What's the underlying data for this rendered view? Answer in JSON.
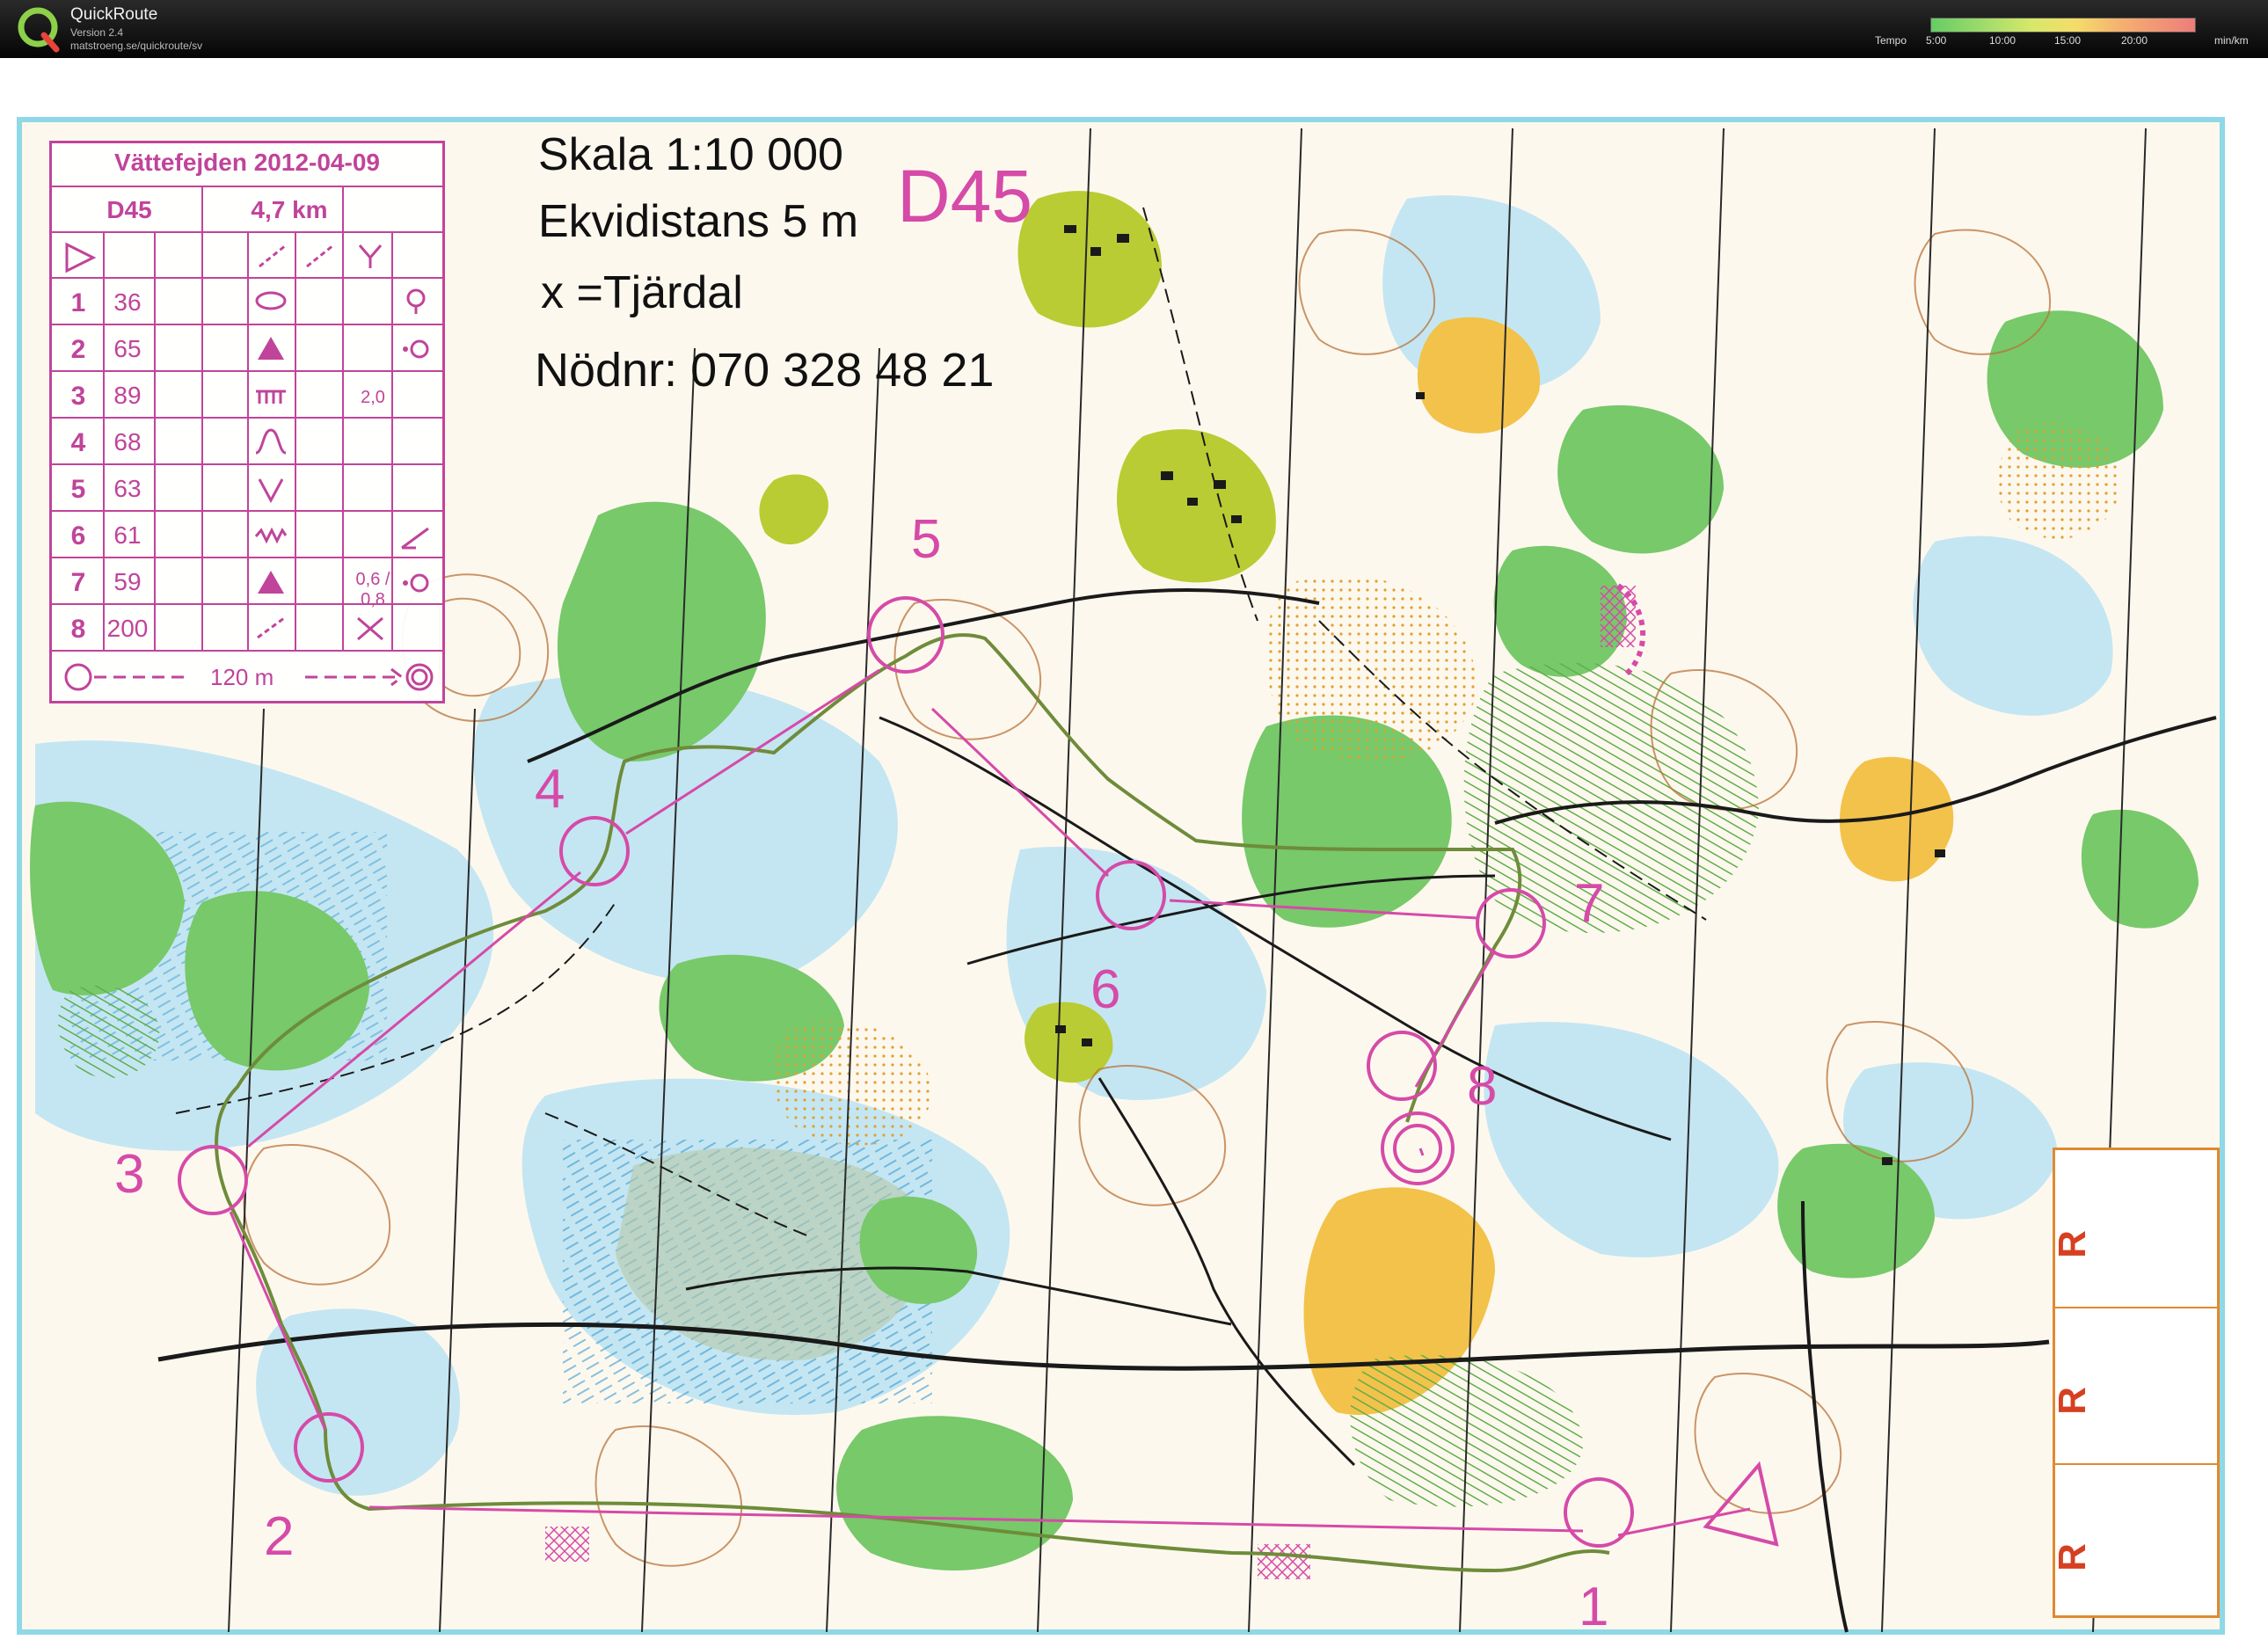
{
  "app": {
    "name": "QuickRoute",
    "version": "Version 2.4",
    "url": "matstroeng.se/quickroute/sv",
    "tempo_label": "Tempo",
    "tempo_ticks": [
      "5:00",
      "10:00",
      "15:00",
      "20:00"
    ],
    "tempo_unit": "min/km"
  },
  "map": {
    "scale": "Skala 1:10 000",
    "equidistance": "Ekvidistans 5 m",
    "legend_note": "x =Tjärdal",
    "emergency": "Nödnr: 070 328 48 21",
    "class_label": "D45",
    "course_color": "#d64aa8",
    "route_color": "#6e8c3a",
    "controls": [
      {
        "label": "1"
      },
      {
        "label": "2"
      },
      {
        "label": "3"
      },
      {
        "label": "4"
      },
      {
        "label": "5"
      },
      {
        "label": "6"
      },
      {
        "label": "7"
      },
      {
        "label": "8"
      }
    ]
  },
  "description_card": {
    "event": "Vättefejden 2012-04-09",
    "class": "D45",
    "length": "4,7 km",
    "rows": [
      {
        "no": "1",
        "code": "36",
        "dim": ""
      },
      {
        "no": "2",
        "code": "65",
        "dim": ""
      },
      {
        "no": "3",
        "code": "89",
        "dim": "2,0"
      },
      {
        "no": "4",
        "code": "68",
        "dim": ""
      },
      {
        "no": "5",
        "code": "63",
        "dim": ""
      },
      {
        "no": "6",
        "code": "61",
        "dim": ""
      },
      {
        "no": "7",
        "code": "59",
        "dim": "0,6 / 0,8"
      },
      {
        "no": "8",
        "code": "200",
        "dim": ""
      }
    ],
    "finish_distance": "120 m"
  },
  "r_panel": {
    "letters": [
      "R",
      "R",
      "R"
    ]
  }
}
